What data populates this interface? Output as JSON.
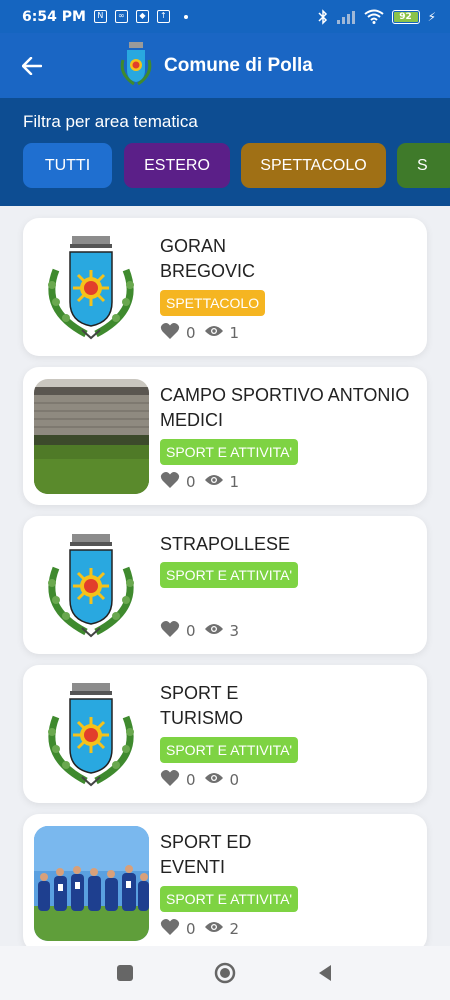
{
  "status_bar": {
    "time": "6:54 PM",
    "battery": "92"
  },
  "app_bar": {
    "title": "Comune di Polla"
  },
  "filter": {
    "label": "Filtra per area tematica",
    "chips": [
      {
        "label": "TUTTI",
        "color": "#1f6fd0"
      },
      {
        "label": "ESTERO",
        "color": "#5b1f88"
      },
      {
        "label": "SPETTACOLO",
        "color": "#a07015"
      },
      {
        "label": "S",
        "color": "#3f7a2a"
      }
    ]
  },
  "events": [
    {
      "title": "GORAN BREGOVIC",
      "tag": "SPETTACOLO",
      "tag_color": "#f5b521",
      "likes": "0",
      "views": "1",
      "image": "coat-of-arms"
    },
    {
      "title": "CAMPO SPORTIVO ANTONIO MEDICI",
      "tag": "SPORT E ATTIVITA'",
      "tag_color": "#7ed343",
      "likes": "0",
      "views": "1",
      "image": "stadium-photo"
    },
    {
      "title": "STRAPOLLESE",
      "tag": "SPORT E ATTIVITA'",
      "tag_color": "#7ed343",
      "likes": "0",
      "views": "3",
      "image": "coat-of-arms"
    },
    {
      "title": "SPORT E TURISMO",
      "tag": "SPORT E ATTIVITA'",
      "tag_color": "#7ed343",
      "likes": "0",
      "views": "0",
      "image": "coat-of-arms"
    },
    {
      "title": "SPORT ED EVENTI",
      "tag": "SPORT E ATTIVITA'",
      "tag_color": "#7ed343",
      "likes": "0",
      "views": "2",
      "image": "team-photo"
    }
  ]
}
